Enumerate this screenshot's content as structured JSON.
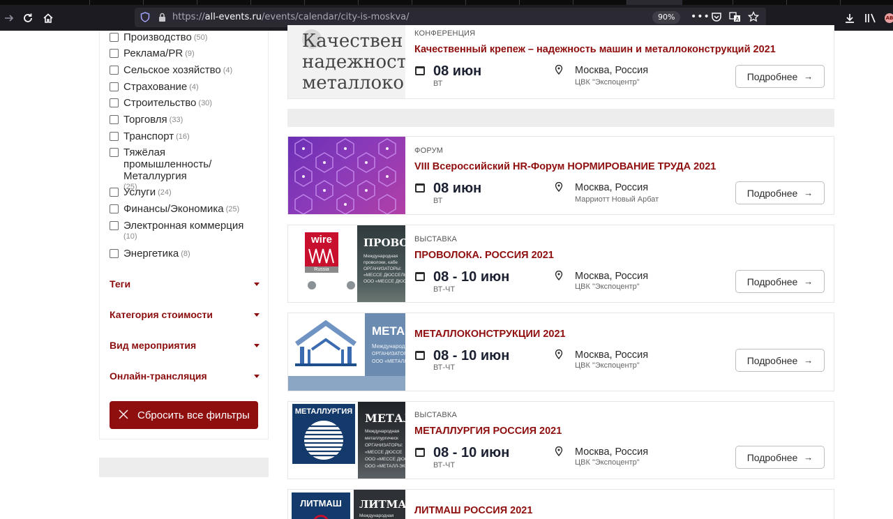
{
  "browser": {
    "url_prefix": "https://",
    "url_host": "all-events.ru",
    "url_path": "/events/calendar/city-is-moskva/",
    "zoom": "90%",
    "extension_badge": "AB"
  },
  "sidebar": {
    "categories": [
      {
        "label": "Производство",
        "count": "(50)"
      },
      {
        "label": "Реклама/PR",
        "count": "(9)"
      },
      {
        "label": "Сельское хозяйство",
        "count": "(4)"
      },
      {
        "label": "Страхование",
        "count": "(4)"
      },
      {
        "label": "Строительство",
        "count": "(30)"
      },
      {
        "label": "Торговля",
        "count": "(33)"
      },
      {
        "label": "Транспорт",
        "count": "(16)"
      },
      {
        "label": "Тяжёлая промышленность/Металлургия",
        "line1": "Тяжёлая",
        "line2": "промышленность/Металлургия",
        "count": "(25)"
      },
      {
        "label": "Услуги",
        "count": "(24)"
      },
      {
        "label": "Финансы/Экономика",
        "count": "(25)"
      },
      {
        "label": "Электронная коммерция",
        "count": "(10)"
      },
      {
        "label": "Энергетика",
        "count": "(8)"
      }
    ],
    "filters": [
      {
        "label": "Теги"
      },
      {
        "label": "Категория стоимости"
      },
      {
        "label": "Вид мероприятия"
      },
      {
        "label": "Онлайн-трансляция"
      }
    ],
    "reset_label": "Сбросить все фильтры"
  },
  "events": [
    {
      "type": "КОНФЕРЕНЦИЯ",
      "title": "Качественный крепеж – надежность машин и металлоконструкций 2021",
      "date": "08 июн",
      "dow": "ВТ",
      "city": "Москва, Россия",
      "venue": "ЦВК \"Экспоцентр\"",
      "button": "Подробнее",
      "thumb_text": [
        "Качествен",
        "надежност",
        "металлоко"
      ]
    },
    {
      "type": "ФОРУМ",
      "title": "VIII Всероссийский HR-Форум НОРМИРОВАНИЕ ТРУДА 2021",
      "date": "08 июн",
      "dow": "ВТ",
      "city": "Москва, Россия",
      "venue": "Марриотт Новый Арбат",
      "button": "Подробнее"
    },
    {
      "type": "ВЫСТАВКА",
      "title": "ПРОВОЛОКА. РОССИЯ 2021",
      "date": "08 - 10 июн",
      "dow": "ВТ-ЧТ",
      "city": "Москва, Россия",
      "venue": "ЦВК \"Экспоцентр\"",
      "button": "Подробнее",
      "thumb_logo": "wire",
      "thumb_logo_sub": "Russia",
      "thumb_heading": "ПРОВОЛ",
      "thumb_lines": [
        "Международная",
        "проволоки, кабе",
        "ОРГАНИЗАТОРЫ:",
        "«МЕССЕ ДЮССЕЛЬ",
        "ООО «МЕССЕ ДЮСС"
      ]
    },
    {
      "type": "",
      "title": "МЕТАЛЛОКОНСТРУКЦИИ 2021",
      "date": "08 - 10 июн",
      "dow": "ВТ-ЧТ",
      "city": "Москва, Россия",
      "venue": "ЦВК \"Экспоцентр\"",
      "button": "Подробнее",
      "thumb_heading": "МЕТА",
      "thumb_lines": [
        "Международ",
        "ОРГАНИЗАТОР",
        "ООО «МЕТАЛЛ"
      ]
    },
    {
      "type": "ВЫСТАВКА",
      "title": "МЕТАЛЛУРГИЯ РОССИЯ 2021",
      "date": "08 - 10 июн",
      "dow": "ВТ-ЧТ",
      "city": "Москва, Россия",
      "venue": "ЦВК \"Экспоцентр\"",
      "button": "Подробнее",
      "thumb_logo": "МЕТАЛЛУРГИЯ",
      "thumb_heading": "МЕТАЛ",
      "thumb_lines": [
        "Международная",
        "металлургическ",
        "ОРГАНИЗАТОРЫ:",
        "«МЕССЕ ДЮССЕ",
        "ООО «МЕССЕ ДЮСС",
        "ООО «МЕТАЛЛ-ЭКСП"
      ]
    },
    {
      "type": "",
      "title": "ЛИТМАШ РОССИЯ 2021",
      "thumb_logo": "ЛИТМАШ",
      "thumb_heading": "ЛИТМАШ",
      "thumb_lines": [
        "Международная"
      ]
    }
  ],
  "colors": {
    "brand_red": "#8f0e0e",
    "chrome_bg": "#1c1b22",
    "urlbar_bg": "#2b2a33"
  }
}
